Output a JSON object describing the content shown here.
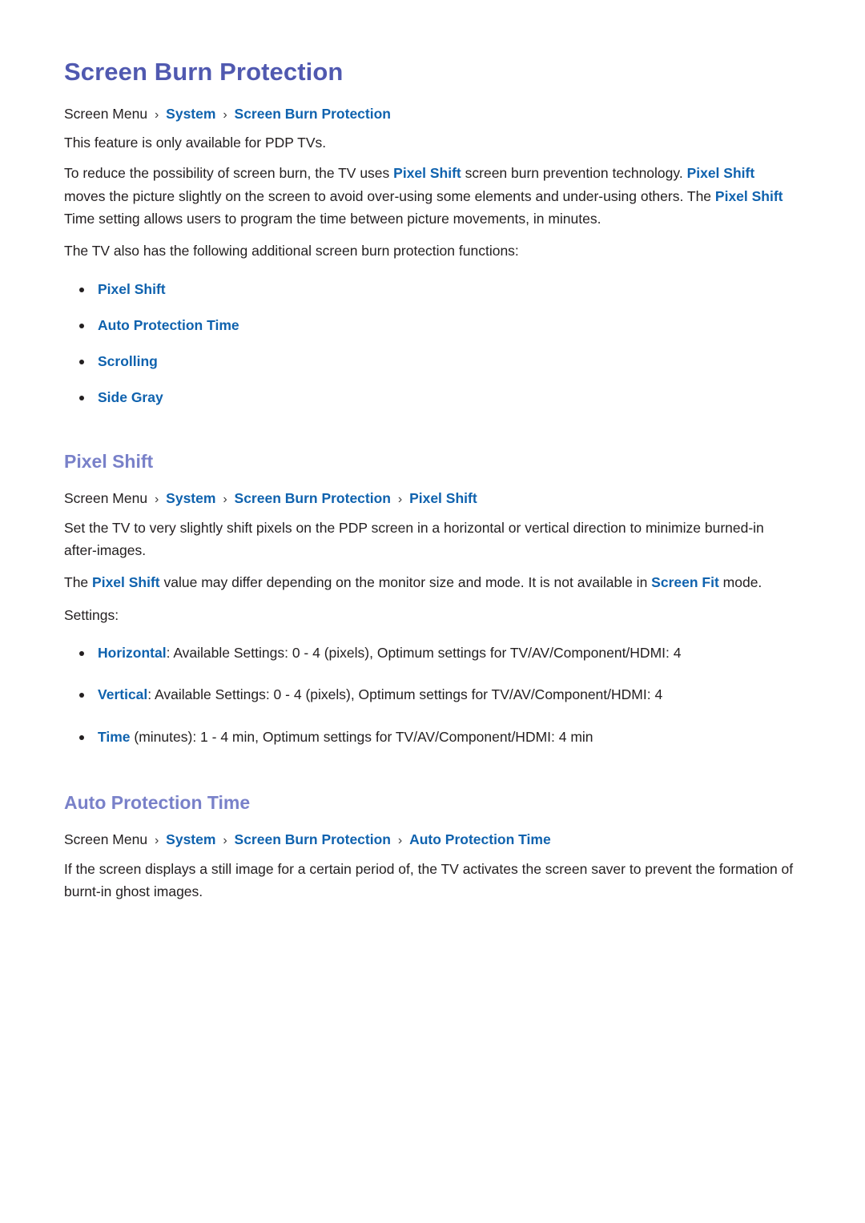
{
  "document": {
    "title": "Screen Burn Protection"
  },
  "intro": {
    "breadcrumb": {
      "root": "Screen Menu",
      "separator": "›",
      "links": [
        "System",
        "Screen Burn Protection"
      ]
    },
    "availability_note": "This feature is only available for PDP TVs.",
    "paragraph_1": {
      "part_1": "To reduce the possibility of screen burn, the TV uses ",
      "link_1": "Pixel Shift",
      "part_2": " screen burn prevention technology. ",
      "link_2": "Pixel Shift",
      "part_3": " moves the picture slightly on the screen to avoid over-using some elements and under-using others. The ",
      "link_3": "Pixel Shift",
      "part_4": " Time setting allows users to program the time between picture movements, in minutes."
    },
    "functions_lead": "The TV also has the following additional screen burn protection functions:",
    "function_links": [
      "Pixel Shift",
      "Auto Protection Time",
      "Scrolling",
      "Side Gray"
    ]
  },
  "pixel_shift": {
    "heading": "Pixel Shift",
    "breadcrumb": {
      "root": "Screen Menu",
      "separator": "›",
      "links": [
        "System",
        "Screen Burn Protection",
        "Pixel Shift"
      ]
    },
    "paragraph_1": "Set the TV to very slightly shift pixels on the PDP screen in a horizontal or vertical direction to minimize burned-in after-images.",
    "paragraph_2": {
      "part_1": "The ",
      "link_1": "Pixel Shift",
      "part_2": " value may differ depending on the monitor size and mode. It is not available in ",
      "link_2": "Screen Fit",
      "part_3": " mode."
    },
    "settings_label": "Settings:",
    "settings": [
      {
        "term": "Horizontal",
        "detail": ": Available Settings: 0 - 4 (pixels), Optimum settings for TV/AV/Component/HDMI: 4"
      },
      {
        "term": "Vertical",
        "detail": ": Available Settings: 0 - 4 (pixels), Optimum settings for TV/AV/Component/HDMI: 4"
      },
      {
        "term": "Time",
        "detail": " (minutes): 1 - 4 min, Optimum settings for TV/AV/Component/HDMI: 4 min"
      }
    ]
  },
  "auto_protection_time": {
    "heading": "Auto Protection Time",
    "breadcrumb": {
      "root": "Screen Menu",
      "separator": "›",
      "links": [
        "System",
        "Screen Burn Protection",
        "Auto Protection Time"
      ]
    },
    "paragraph_1": "If the screen displays a still image for a certain period of, the TV activates the screen saver to prevent the formation of burnt-in ghost images."
  },
  "colors": {
    "title": "#5059b0",
    "section_heading": "#7981c9",
    "link": "#0f62ae",
    "body_text": "#231f20",
    "background": "#ffffff"
  }
}
